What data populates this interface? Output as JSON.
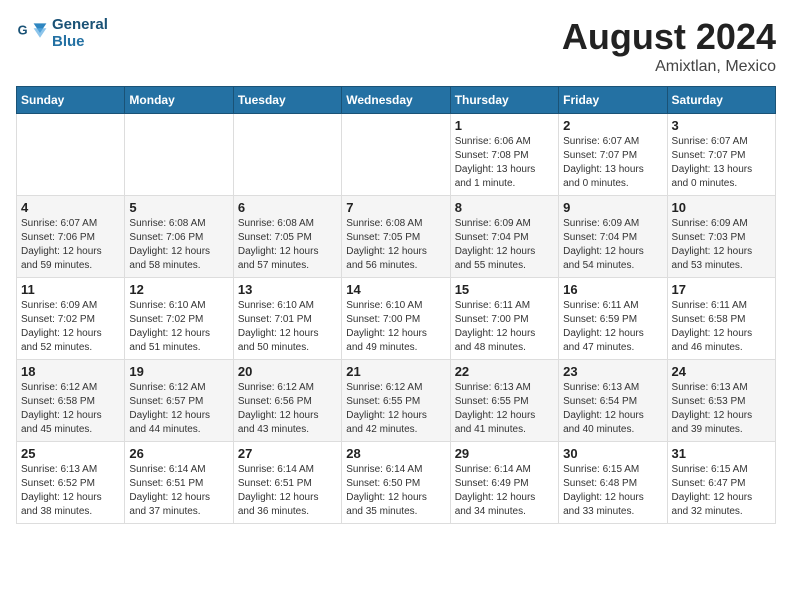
{
  "header": {
    "logo_line1": "General",
    "logo_line2": "Blue",
    "title": "August 2024",
    "subtitle": "Amixtlan, Mexico"
  },
  "days_of_week": [
    "Sunday",
    "Monday",
    "Tuesday",
    "Wednesday",
    "Thursday",
    "Friday",
    "Saturday"
  ],
  "weeks": [
    [
      {
        "num": "",
        "detail": ""
      },
      {
        "num": "",
        "detail": ""
      },
      {
        "num": "",
        "detail": ""
      },
      {
        "num": "",
        "detail": ""
      },
      {
        "num": "1",
        "detail": "Sunrise: 6:06 AM\nSunset: 7:08 PM\nDaylight: 13 hours\nand 1 minute."
      },
      {
        "num": "2",
        "detail": "Sunrise: 6:07 AM\nSunset: 7:07 PM\nDaylight: 13 hours\nand 0 minutes."
      },
      {
        "num": "3",
        "detail": "Sunrise: 6:07 AM\nSunset: 7:07 PM\nDaylight: 13 hours\nand 0 minutes."
      }
    ],
    [
      {
        "num": "4",
        "detail": "Sunrise: 6:07 AM\nSunset: 7:06 PM\nDaylight: 12 hours\nand 59 minutes."
      },
      {
        "num": "5",
        "detail": "Sunrise: 6:08 AM\nSunset: 7:06 PM\nDaylight: 12 hours\nand 58 minutes."
      },
      {
        "num": "6",
        "detail": "Sunrise: 6:08 AM\nSunset: 7:05 PM\nDaylight: 12 hours\nand 57 minutes."
      },
      {
        "num": "7",
        "detail": "Sunrise: 6:08 AM\nSunset: 7:05 PM\nDaylight: 12 hours\nand 56 minutes."
      },
      {
        "num": "8",
        "detail": "Sunrise: 6:09 AM\nSunset: 7:04 PM\nDaylight: 12 hours\nand 55 minutes."
      },
      {
        "num": "9",
        "detail": "Sunrise: 6:09 AM\nSunset: 7:04 PM\nDaylight: 12 hours\nand 54 minutes."
      },
      {
        "num": "10",
        "detail": "Sunrise: 6:09 AM\nSunset: 7:03 PM\nDaylight: 12 hours\nand 53 minutes."
      }
    ],
    [
      {
        "num": "11",
        "detail": "Sunrise: 6:09 AM\nSunset: 7:02 PM\nDaylight: 12 hours\nand 52 minutes."
      },
      {
        "num": "12",
        "detail": "Sunrise: 6:10 AM\nSunset: 7:02 PM\nDaylight: 12 hours\nand 51 minutes."
      },
      {
        "num": "13",
        "detail": "Sunrise: 6:10 AM\nSunset: 7:01 PM\nDaylight: 12 hours\nand 50 minutes."
      },
      {
        "num": "14",
        "detail": "Sunrise: 6:10 AM\nSunset: 7:00 PM\nDaylight: 12 hours\nand 49 minutes."
      },
      {
        "num": "15",
        "detail": "Sunrise: 6:11 AM\nSunset: 7:00 PM\nDaylight: 12 hours\nand 48 minutes."
      },
      {
        "num": "16",
        "detail": "Sunrise: 6:11 AM\nSunset: 6:59 PM\nDaylight: 12 hours\nand 47 minutes."
      },
      {
        "num": "17",
        "detail": "Sunrise: 6:11 AM\nSunset: 6:58 PM\nDaylight: 12 hours\nand 46 minutes."
      }
    ],
    [
      {
        "num": "18",
        "detail": "Sunrise: 6:12 AM\nSunset: 6:58 PM\nDaylight: 12 hours\nand 45 minutes."
      },
      {
        "num": "19",
        "detail": "Sunrise: 6:12 AM\nSunset: 6:57 PM\nDaylight: 12 hours\nand 44 minutes."
      },
      {
        "num": "20",
        "detail": "Sunrise: 6:12 AM\nSunset: 6:56 PM\nDaylight: 12 hours\nand 43 minutes."
      },
      {
        "num": "21",
        "detail": "Sunrise: 6:12 AM\nSunset: 6:55 PM\nDaylight: 12 hours\nand 42 minutes."
      },
      {
        "num": "22",
        "detail": "Sunrise: 6:13 AM\nSunset: 6:55 PM\nDaylight: 12 hours\nand 41 minutes."
      },
      {
        "num": "23",
        "detail": "Sunrise: 6:13 AM\nSunset: 6:54 PM\nDaylight: 12 hours\nand 40 minutes."
      },
      {
        "num": "24",
        "detail": "Sunrise: 6:13 AM\nSunset: 6:53 PM\nDaylight: 12 hours\nand 39 minutes."
      }
    ],
    [
      {
        "num": "25",
        "detail": "Sunrise: 6:13 AM\nSunset: 6:52 PM\nDaylight: 12 hours\nand 38 minutes."
      },
      {
        "num": "26",
        "detail": "Sunrise: 6:14 AM\nSunset: 6:51 PM\nDaylight: 12 hours\nand 37 minutes."
      },
      {
        "num": "27",
        "detail": "Sunrise: 6:14 AM\nSunset: 6:51 PM\nDaylight: 12 hours\nand 36 minutes."
      },
      {
        "num": "28",
        "detail": "Sunrise: 6:14 AM\nSunset: 6:50 PM\nDaylight: 12 hours\nand 35 minutes."
      },
      {
        "num": "29",
        "detail": "Sunrise: 6:14 AM\nSunset: 6:49 PM\nDaylight: 12 hours\nand 34 minutes."
      },
      {
        "num": "30",
        "detail": "Sunrise: 6:15 AM\nSunset: 6:48 PM\nDaylight: 12 hours\nand 33 minutes."
      },
      {
        "num": "31",
        "detail": "Sunrise: 6:15 AM\nSunset: 6:47 PM\nDaylight: 12 hours\nand 32 minutes."
      }
    ]
  ]
}
